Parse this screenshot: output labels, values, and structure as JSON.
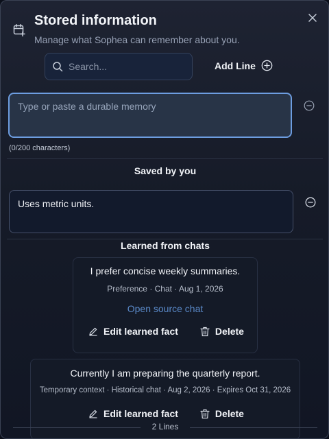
{
  "header": {
    "title": "Stored information",
    "subtitle": "Manage what Sophea can remember about you."
  },
  "search": {
    "placeholder": "Search...",
    "value": ""
  },
  "add_line": {
    "label": "Add Line"
  },
  "new_memory": {
    "placeholder": "Type or paste a durable memory",
    "value": "",
    "counter": "(0/200 characters)"
  },
  "saved_section": {
    "title": "Saved by you",
    "items": [
      {
        "value": "Uses metric units."
      }
    ]
  },
  "learned_section": {
    "title": "Learned from chats",
    "cards": [
      {
        "fact": "I prefer concise weekly summaries.",
        "meta": "Preference · Chat · Aug 1, 2026",
        "link": "Open source chat",
        "edit_label": "Edit learned fact",
        "delete_label": "Delete"
      },
      {
        "fact": "Currently I am preparing the quarterly report.",
        "meta": "Temporary context · Historical chat · Aug 2, 2026 · Expires Oct 31, 2026",
        "edit_label": "Edit learned fact",
        "delete_label": "Delete"
      }
    ]
  },
  "footer": {
    "count": "2 Lines"
  }
}
